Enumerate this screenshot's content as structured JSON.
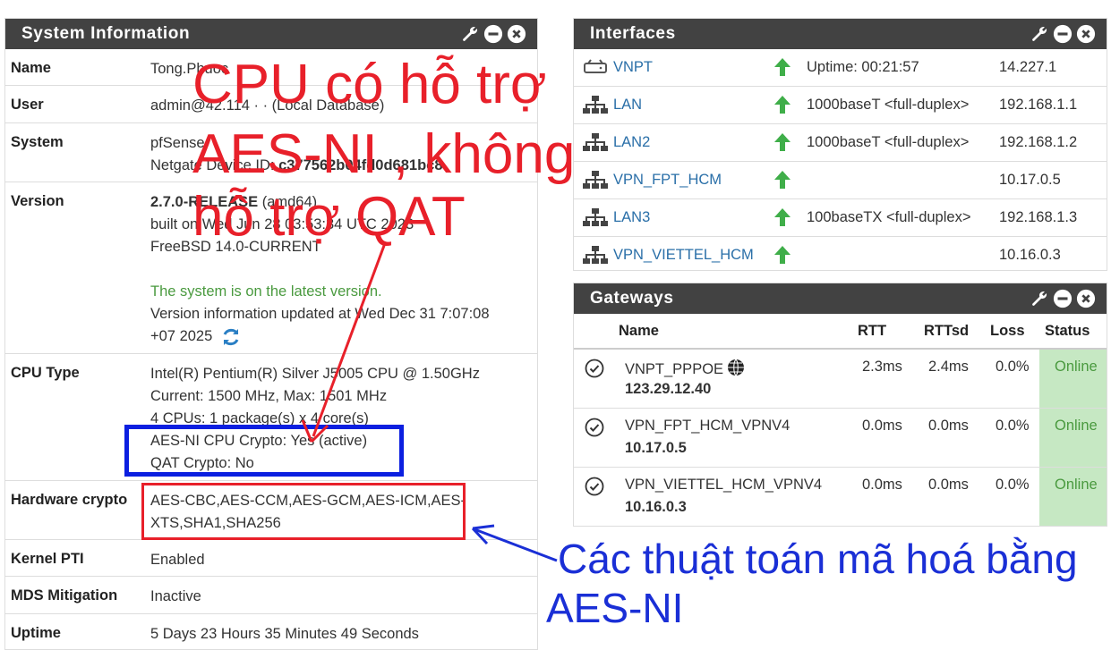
{
  "system_info": {
    "title": "System Information",
    "rows": {
      "name": {
        "label": "Name",
        "value": "Tong.Phuoc"
      },
      "user": {
        "label": "User",
        "value": "admin@42.114 ·  ·   (Local Database)"
      },
      "system": {
        "label": "System",
        "line1": "pfSense",
        "line2_prefix": "Netgate Device ID: ",
        "line2_bold": "c377562b04fd0d681bc8"
      },
      "version": {
        "label": "Version",
        "line1_bold": "2.7.0-RELEASE",
        "line1_rest": " (amd64)",
        "line2": "built on Wed Jun 28 03:53:34 UTC 2023",
        "line3": "FreeBSD 14.0-CURRENT",
        "status": "The system is on the latest version.",
        "updated1": "Version information updated at Wed Dec 31 7:07:08",
        "updated2": "+07 2025"
      },
      "cpu": {
        "label": "CPU Type",
        "line1": "Intel(R) Pentium(R) Silver J5005 CPU @ 1.50GHz",
        "line2": "Current: 1500 MHz, Max: 1501 MHz",
        "line3": "4 CPUs: 1 package(s) x 4 core(s)",
        "line4": "AES-NI CPU Crypto: Yes (active)",
        "line5": "QAT Crypto: No"
      },
      "hwcrypto": {
        "label": "Hardware crypto",
        "line1": "AES-CBC,AES-CCM,AES-GCM,AES-ICM,AES-",
        "line2": "XTS,SHA1,SHA256"
      },
      "kpti": {
        "label": "Kernel PTI",
        "value": "Enabled"
      },
      "mds": {
        "label": "MDS Mitigation",
        "value": "Inactive"
      },
      "uptime": {
        "label": "Uptime",
        "value": "5 Days 23 Hours 35 Minutes 49 Seconds"
      }
    }
  },
  "interfaces": {
    "title": "Interfaces",
    "rows": [
      {
        "name": "VNPT",
        "icon": "wan-icon",
        "mode": "Uptime: 00:21:57",
        "ip": "14.227.1"
      },
      {
        "name": "LAN",
        "icon": "network-icon",
        "mode": "1000baseT <full-duplex>",
        "ip": "192.168.1.1"
      },
      {
        "name": "LAN2",
        "icon": "network-icon",
        "mode": "1000baseT <full-duplex>",
        "ip": "192.168.1.2"
      },
      {
        "name": "VPN_FPT_HCM",
        "icon": "network-icon",
        "mode": "",
        "ip": "10.17.0.5"
      },
      {
        "name": "LAN3",
        "icon": "network-icon",
        "mode": "100baseTX <full-duplex>",
        "ip": "192.168.1.3"
      },
      {
        "name": "VPN_VIETTEL_HCM",
        "icon": "network-icon",
        "mode": "",
        "ip": "10.16.0.3"
      }
    ]
  },
  "gateways": {
    "title": "Gateways",
    "columns": {
      "name": "Name",
      "rtt": "RTT",
      "rttsd": "RTTsd",
      "loss": "Loss",
      "status": "Status"
    },
    "rows": [
      {
        "name": "VNPT_PPPOE",
        "ip": "123.29.12.40",
        "rtt": "2.3ms",
        "rttsd": "2.4ms",
        "loss": "0.0%",
        "status": "Online"
      },
      {
        "name": "VPN_FPT_HCM_VPNV4",
        "ip": "10.17.0.5",
        "rtt": "0.0ms",
        "rttsd": "0.0ms",
        "loss": "0.0%",
        "status": "Online"
      },
      {
        "name": "VPN_VIETTEL_HCM_VPNV4",
        "ip": "10.16.0.3",
        "rtt": "0.0ms",
        "rttsd": "0.0ms",
        "loss": "0.0%",
        "status": "Online"
      }
    ]
  },
  "annotations": {
    "red_line1": "CPU có hỗ trợ",
    "red_line2": "AES-NI , không",
    "red_line3": "hỗ trợ QAT",
    "blue_line1": "Các thuật toán mã hoá bằng",
    "blue_line2": "AES-NI"
  },
  "colors": {
    "panel_header": "#424242",
    "link": "#2a6fa8",
    "online_bg": "#c6e8c3",
    "online_text": "#4a9a3f",
    "annotation_red": "#e8202a",
    "annotation_blue": "#1a2fd6"
  }
}
